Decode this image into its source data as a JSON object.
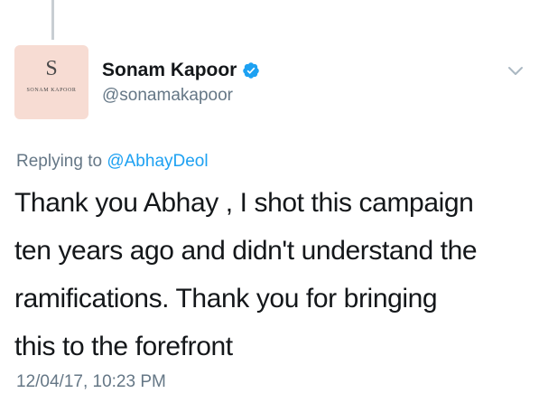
{
  "avatar": {
    "monogram": "S",
    "caption": "SONAM KAPOOR",
    "background": "#f7dcd3"
  },
  "author": {
    "display_name": "Sonam Kapoor",
    "handle": "@sonamakapoor",
    "verified": true,
    "verified_icon": "verified-badge-icon",
    "verified_color": "#1da1f2"
  },
  "menu": {
    "icon": "chevron-down-icon"
  },
  "reply": {
    "prefix": "Replying to",
    "mention": "@AbhayDeol"
  },
  "tweet": {
    "lines": [
      "Thank you Abhay , I shot this campaign",
      "ten years ago and didn't understand the",
      "ramifications. Thank you for bringing",
      "this to the forefront"
    ]
  },
  "meta": {
    "timestamp": "12/04/17, 10:23 PM"
  },
  "colors": {
    "text": "#14171a",
    "secondary": "#657786",
    "link": "#1da1f2",
    "thread_line": "#c8ced3"
  }
}
